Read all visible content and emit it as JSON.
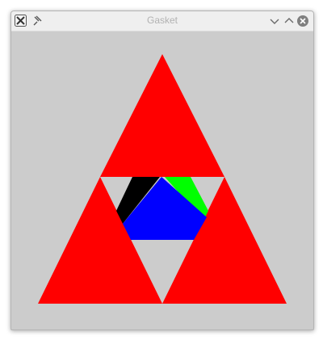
{
  "window": {
    "title": "Gasket",
    "app_icon": "x-app-icon",
    "controls": [
      {
        "name": "minimize-button",
        "icon": "chevron-down-icon"
      },
      {
        "name": "maximize-button",
        "icon": "chevron-up-icon"
      },
      {
        "name": "close-button",
        "icon": "close-icon"
      }
    ]
  },
  "colors": {
    "background": "#cccccc",
    "titlebar": "#efefef",
    "title_text": "#b2b2b2",
    "red": "#ff0000",
    "black": "#000000",
    "green": "#00ff00",
    "blue": "#0000ff"
  }
}
